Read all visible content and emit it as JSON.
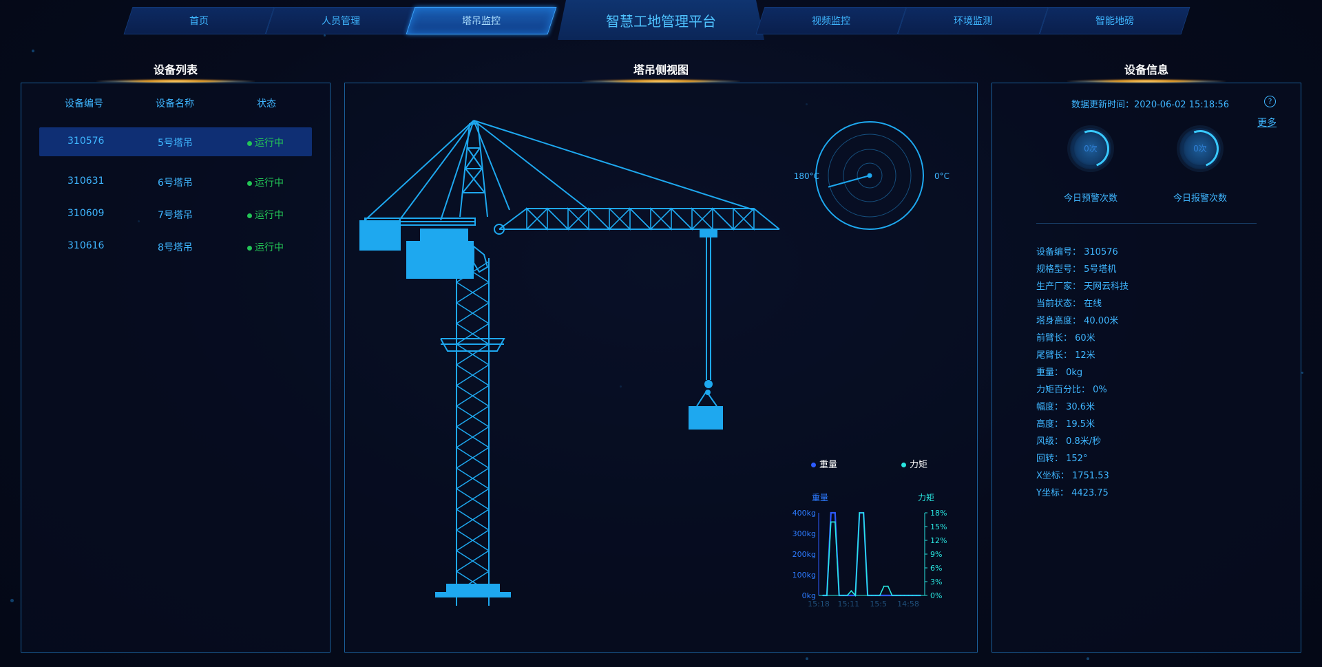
{
  "nav": {
    "tabs": [
      {
        "label": "首页"
      },
      {
        "label": "人员管理"
      },
      {
        "label": "塔吊监控"
      },
      {
        "label": "视频监控"
      },
      {
        "label": "环境监测"
      },
      {
        "label": "智能地磅"
      }
    ],
    "active_tab": "塔吊监控",
    "title": "智慧工地管理平台"
  },
  "left_panel": {
    "title": "设备列表",
    "columns": [
      "设备编号",
      "设备名称",
      "状态"
    ],
    "rows": [
      {
        "id": "310576",
        "name": "5号塔吊",
        "status": "运行中"
      },
      {
        "id": "310631",
        "name": "6号塔吊",
        "status": "运行中"
      },
      {
        "id": "310609",
        "name": "7号塔吊",
        "status": "运行中"
      },
      {
        "id": "310616",
        "name": "8号塔吊",
        "status": "运行中"
      }
    ],
    "selected_row": "310576"
  },
  "center_panel": {
    "title": "塔吊侧视图",
    "compass": {
      "left_label": "180°C",
      "right_label": "0°C",
      "rotation_deg": 152
    },
    "legend": [
      {
        "name": "重量",
        "color": "#2d5bff"
      },
      {
        "name": "力矩",
        "color": "#29e6e0"
      }
    ]
  },
  "chart_data": {
    "type": "line",
    "x": [
      "15:18",
      "15:11",
      "15:5",
      "14:58"
    ],
    "left_axis": {
      "label": "重量",
      "ticks": [
        "400kg",
        "300kg",
        "200kg",
        "100kg",
        "0kg"
      ],
      "ylim": [
        0,
        400
      ]
    },
    "right_axis": {
      "label": "力矩",
      "ticks": [
        "18%",
        "15%",
        "12%",
        "9%",
        "6%",
        "3%",
        "0%"
      ],
      "ylim": [
        0,
        18
      ]
    },
    "series": [
      {
        "name": "重量",
        "color": "#2d5bff",
        "values": [
          0,
          0,
          400,
          400,
          0,
          0,
          0,
          0,
          0,
          400,
          400,
          0,
          0,
          0,
          0,
          0,
          0,
          0,
          0,
          0,
          0,
          0,
          0,
          0,
          0
        ]
      },
      {
        "name": "力矩",
        "color": "#29e6e0",
        "values": [
          0,
          0,
          16,
          16,
          0,
          0,
          0,
          1,
          0,
          18,
          18,
          0,
          0,
          0,
          0,
          2,
          2,
          0,
          0,
          0,
          0,
          0,
          0,
          0,
          0
        ]
      }
    ]
  },
  "right_panel": {
    "title": "设备信息",
    "update_time": "数据更新时间：2020-06-02 15:18:56",
    "help_icon": "?",
    "more_link": "更多",
    "gauges": [
      {
        "value": "0次",
        "label": "今日预警次数"
      },
      {
        "value": "0次",
        "label": "今日报警次数"
      }
    ],
    "info": [
      "设备编号： 310576",
      "规格型号： 5号塔机",
      "生产厂家： 天网云科技",
      "当前状态： 在线",
      "塔身高度： 40.00米",
      "前臂长： 60米",
      "尾臂长： 12米",
      "重量： 0kg",
      "力矩百分比： 0%",
      "幅度： 30.6米",
      "高度： 19.5米",
      "风级： 0.8米/秒",
      "回转： 152°",
      "X坐标： 1751.53",
      "Y坐标： 4423.75"
    ]
  },
  "colors": {
    "accent": "#3fb6ff",
    "status_green": "#23c556",
    "crane": "#1ea8ef",
    "panel_border": "#1a5f9a"
  }
}
